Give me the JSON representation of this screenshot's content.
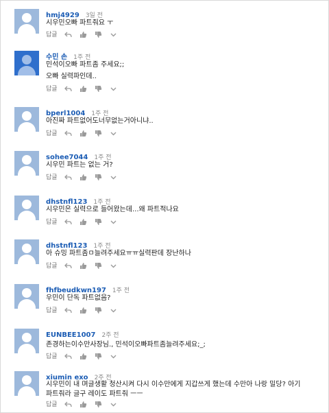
{
  "comments": [
    {
      "author": "hmj4929",
      "time": "3일 전",
      "lines": [
        "시우민오빠 파트줘요 ㅜ"
      ],
      "avatar": "gray",
      "reply": "답글"
    },
    {
      "author": "수민 손",
      "time": "1주 전",
      "lines": [
        "민석이오빠 파트좀 주세요;;",
        "오빠 실력파인데.."
      ],
      "avatar": "blue",
      "reply": "답글"
    },
    {
      "author": "bperl1004",
      "time": "1주 전",
      "lines": [
        "아진짜 파트없어도너무없는거아니냐.."
      ],
      "avatar": "gray",
      "reply": "답글"
    },
    {
      "author": "sohee7044",
      "time": "1주 전",
      "lines": [
        "시우민 파트는 없는 거?"
      ],
      "avatar": "gray",
      "reply": "답글"
    },
    {
      "author": "dhstnfl123",
      "time": "1주 전",
      "lines": [
        "시우민은 실력으로 들어왔는데...왜 파트적나요"
      ],
      "avatar": "gray",
      "reply": "답글"
    },
    {
      "author": "dhstnfl123",
      "time": "1주 전",
      "lines": [
        "아 슈밍 파트좀ㅁ늘려주세요ㅠㅠ실력판데 장난하나"
      ],
      "avatar": "gray",
      "reply": "답글"
    },
    {
      "author": "fhfbeudkwn197",
      "time": "1주 전",
      "lines": [
        "우민이 단독 파트없음?"
      ],
      "avatar": "gray",
      "reply": "답글"
    },
    {
      "author": "EUNBEE1007",
      "time": "2주 전",
      "lines": [
        "존경하는이수만사장님., 민석이오빠파트좀늘려주세요;_;"
      ],
      "avatar": "gray",
      "reply": "답글"
    },
    {
      "author": "xiumin exo",
      "time": "2주 전",
      "lines": [
        "시우민이 내 며글생활 청산시켜 다시 이수만에게 지갑쓰게 했는데 수만아 나랑 밀당? 아기",
        "파트줘라 글구 레이도 파트줘 ㅡㅡ"
      ],
      "avatar": "gray",
      "reply": "답글"
    }
  ],
  "icons": {
    "reply_icon": "reply-arrow-icon",
    "like_icon": "thumbs-up-icon",
    "dislike_icon": "thumbs-down-icon",
    "menu_icon": "more-icon"
  },
  "colors": {
    "author": "#1b5cb4",
    "avatar_default": "#9db9dc",
    "avatar_blue": "#2f6fcc"
  }
}
